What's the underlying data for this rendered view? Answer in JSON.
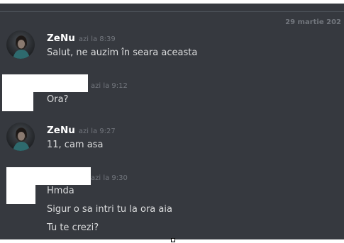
{
  "chat": {
    "date_divider": "29 martie 202",
    "messages": [
      {
        "author": "ZeNu",
        "timestamp": "azi la 8:39",
        "lines": [
          "Salut, ne auzim în seara aceasta"
        ]
      },
      {
        "author": "",
        "timestamp": "azi la 9:12",
        "lines": [
          "Ora?"
        ]
      },
      {
        "author": "ZeNu",
        "timestamp": "azi la 9:27",
        "lines": [
          "11, cam asa"
        ]
      },
      {
        "author": "",
        "timestamp": "azi la 9:30",
        "lines": [
          "Hmda",
          "Sigur o sa intri tu la ora aia",
          "Tu te crezi?"
        ]
      }
    ]
  },
  "colors": {
    "background": "#36393f",
    "username": "#ffffff",
    "message_text": "#dcddde",
    "timestamp": "#72767d",
    "divider": "#4f545c"
  },
  "icons": {
    "avatar": "avatar-image-icon"
  }
}
